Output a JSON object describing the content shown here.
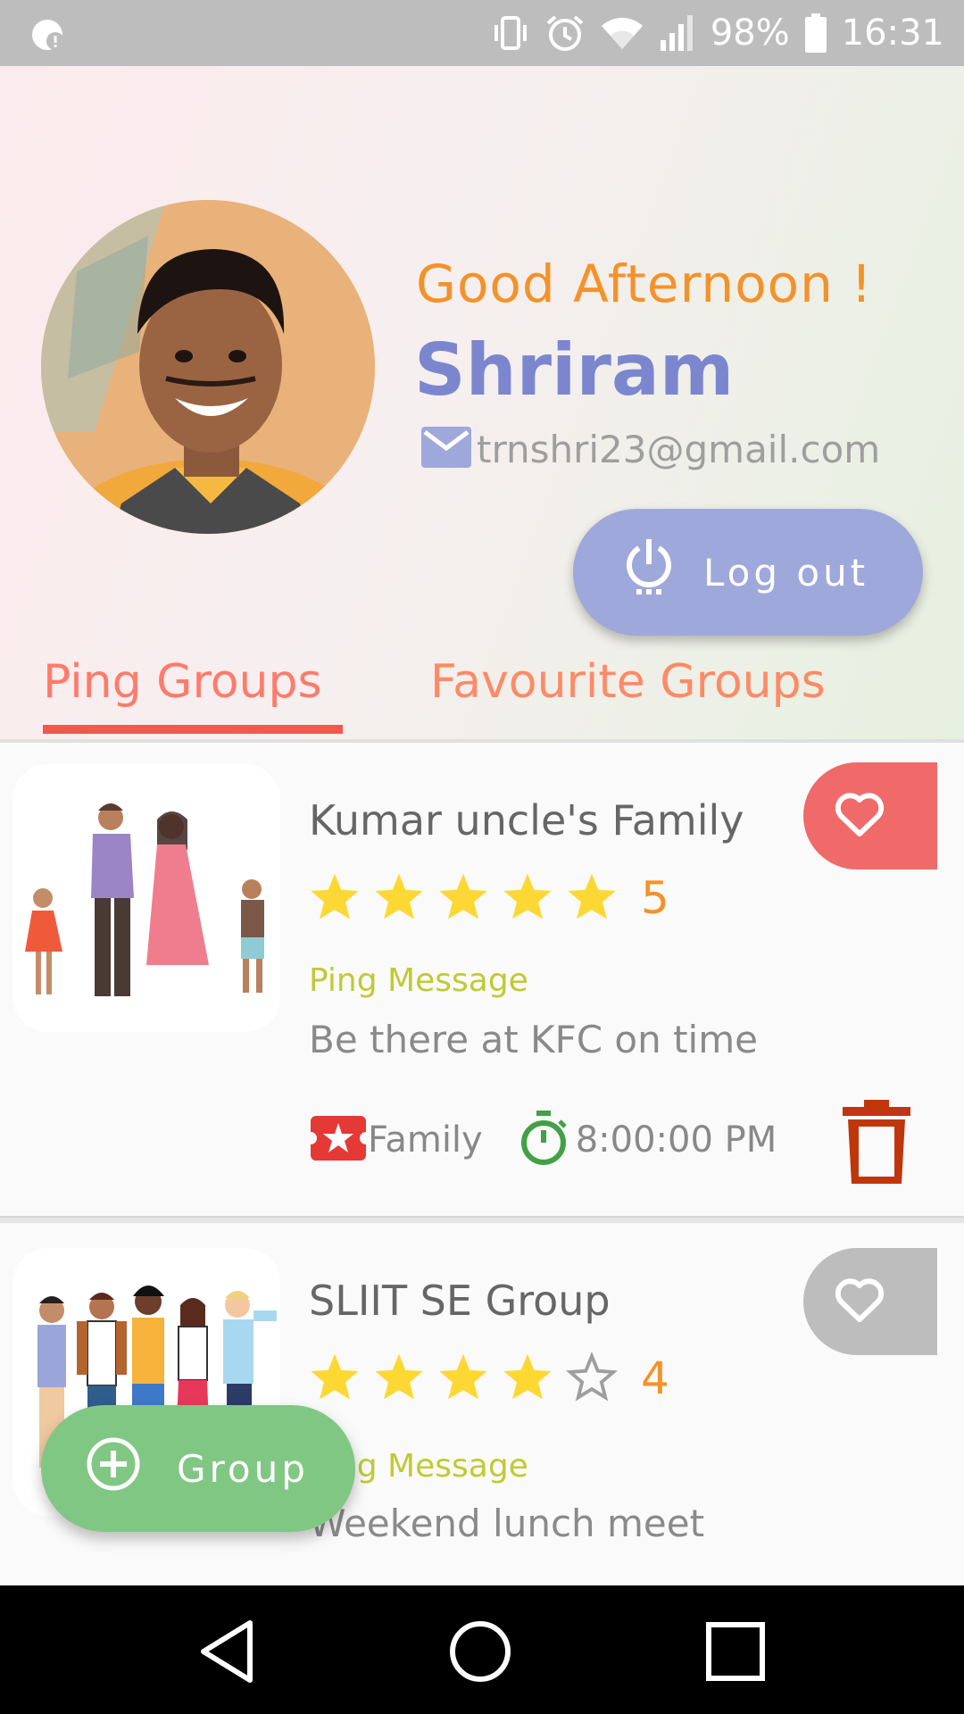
{
  "status_bar": {
    "battery_percent": "98%",
    "time": "16:31",
    "icons": [
      "notification-icon",
      "vibrate-icon",
      "alarm-icon",
      "wifi-icon",
      "signal-icon",
      "battery-icon"
    ]
  },
  "profile": {
    "greeting": "Good Afternoon !",
    "name": "Shriram",
    "email": "trnshri23@gmail.com",
    "logout_label": "Log out"
  },
  "tabs": [
    {
      "label": "Ping Groups",
      "active": true
    },
    {
      "label": "Favourite Groups",
      "active": false
    }
  ],
  "groups": [
    {
      "name": "Kumar uncle's Family",
      "rating": 5,
      "rating_label": "5",
      "message_label": "Ping Message",
      "message": "Be there at KFC on time",
      "category": "Family",
      "time": "8:00:00 PM",
      "favourite": true
    },
    {
      "name": "SLIIT SE Group",
      "rating": 4,
      "rating_label": "4",
      "message_label": "Ping Message",
      "message": "Weekend lunch meet",
      "favourite": false
    }
  ],
  "fab": {
    "label": "Group"
  },
  "colors": {
    "accent_orange": "#f4922a",
    "name_blue": "#7c86cf",
    "logout_bg": "#9fa8da",
    "tab_indicator": "#f4574f",
    "fav_active": "#f06a6a",
    "fav_inactive": "#bdbdbd",
    "fab_green": "#81c784",
    "star_yellow": "#fdd835",
    "delete_red": "#bf360c",
    "timer_green": "#43a047"
  }
}
